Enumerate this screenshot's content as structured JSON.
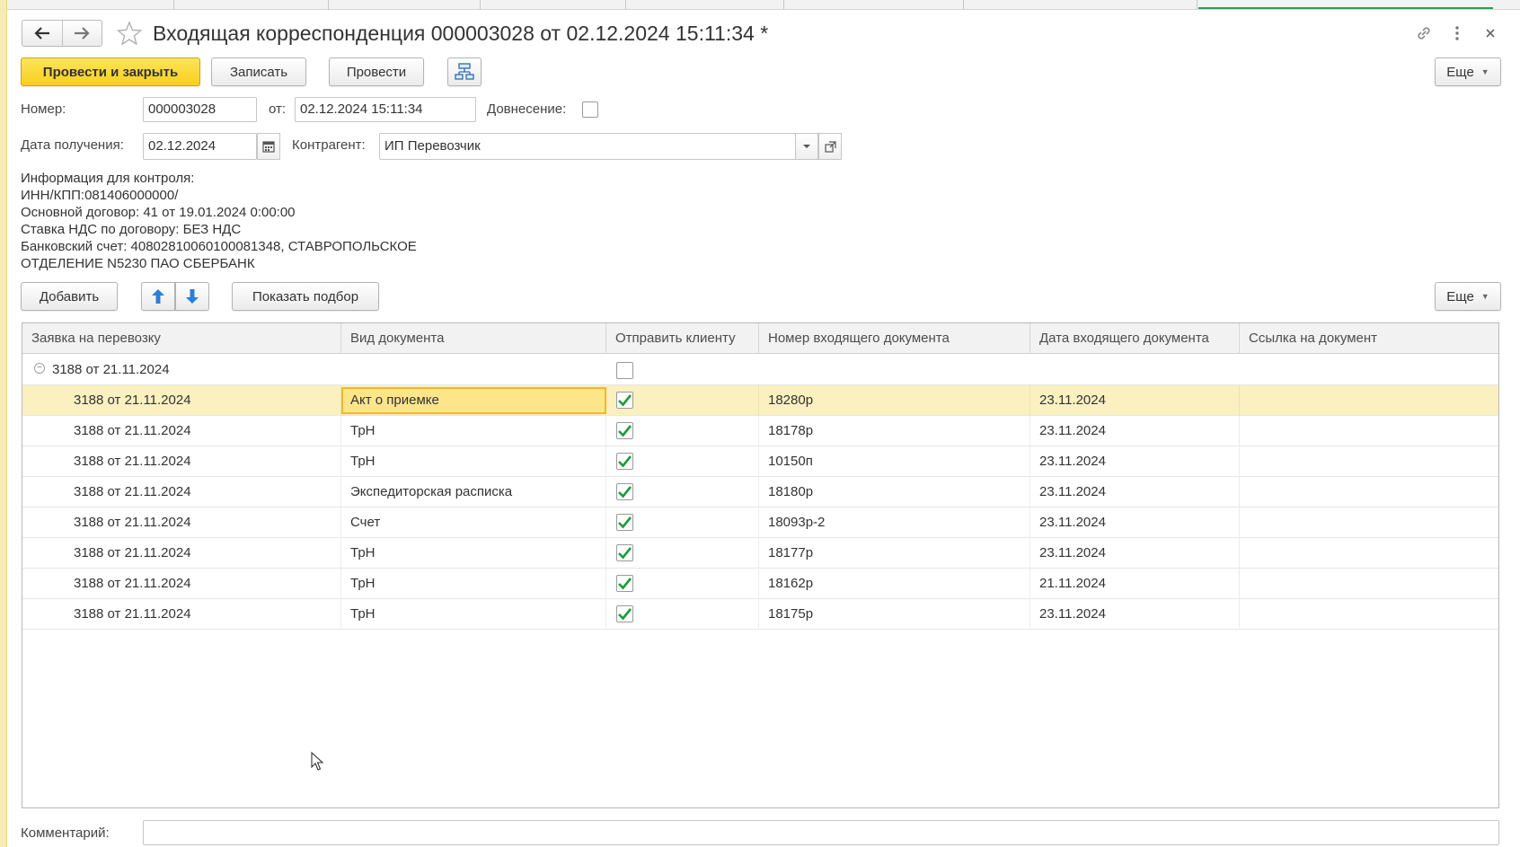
{
  "window": {
    "title": "Входящая корреспонденция 000003028 от 02.12.2024 15:11:34 *"
  },
  "toolbar": {
    "post_and_close": "Провести и закрыть",
    "save": "Записать",
    "post": "Провести",
    "more": "Еще"
  },
  "form": {
    "number_label": "Номер:",
    "number_value": "000003028",
    "from_label": "от:",
    "from_value": "02.12.2024 15:11:34",
    "late_delivery_label": "Довнесение:",
    "receipt_date_label": "Дата получения:",
    "receipt_date_value": "02.12.2024",
    "counterparty_label": "Контрагент:",
    "counterparty_value": "ИП Перевозчик"
  },
  "info": {
    "lines": [
      "Информация для контроля:",
      "ИНН/КПП:081406000000/",
      "Основной договор: 41 от 19.01.2024 0:00:00",
      "Ставка НДС по договору: БЕЗ НДС",
      "Банковский счет: 40802810060100081348, СТАВРОПОЛЬСКОЕ",
      "ОТДЕЛЕНИЕ N5230 ПАО СБЕРБАНК"
    ]
  },
  "table_toolbar": {
    "add": "Добавить",
    "show_selection": "Показать подбор",
    "more": "Еще"
  },
  "table": {
    "columns": [
      "Заявка на перевозку",
      "Вид документа",
      "Отправить клиенту",
      "Номер входящего документа",
      "Дата входящего документа",
      "Ссылка на документ"
    ],
    "group": {
      "label": "3188 от 21.11.2024",
      "checked": false
    },
    "rows": [
      {
        "request": "3188 от 21.11.2024",
        "doc_type": "Акт о приемке",
        "send": true,
        "number": "18280р",
        "date": "23.11.2024",
        "link": ""
      },
      {
        "request": "3188 от 21.11.2024",
        "doc_type": "ТрН",
        "send": true,
        "number": "18178р",
        "date": "23.11.2024",
        "link": ""
      },
      {
        "request": "3188 от 21.11.2024",
        "doc_type": "ТрН",
        "send": true,
        "number": "10150п",
        "date": "23.11.2024",
        "link": ""
      },
      {
        "request": "3188 от 21.11.2024",
        "doc_type": "Экспедиторская расписка",
        "send": true,
        "number": "18180р",
        "date": "23.11.2024",
        "link": ""
      },
      {
        "request": "3188 от 21.11.2024",
        "doc_type": "Счет",
        "send": true,
        "number": "18093р-2",
        "date": "23.11.2024",
        "link": ""
      },
      {
        "request": "3188 от 21.11.2024",
        "doc_type": "ТрН",
        "send": true,
        "number": "18177р",
        "date": "23.11.2024",
        "link": ""
      },
      {
        "request": "3188 от 21.11.2024",
        "doc_type": "ТрН",
        "send": true,
        "number": "18162р",
        "date": "21.11.2024",
        "link": ""
      },
      {
        "request": "3188 от 21.11.2024",
        "doc_type": "ТрН",
        "send": true,
        "number": "18175р",
        "date": "23.11.2024",
        "link": ""
      }
    ]
  },
  "footer": {
    "comment_label": "Комментарий:",
    "comment_value": ""
  },
  "icons": {
    "back": "arrow-left-icon",
    "forward": "arrow-right-icon",
    "favorite": "star-icon",
    "link": "link-icon",
    "menu": "kebab-menu-icon",
    "close": "close-icon",
    "structure": "structure-icon",
    "calendar": "calendar-icon",
    "dropdown": "chevron-down-icon",
    "open": "open-icon",
    "move_up": "arrow-up-icon",
    "move_down": "arrow-down-icon",
    "checkmark": "checkmark-icon",
    "collapse": "collapse-icon"
  },
  "colors": {
    "primary_button": "#f7cf1c",
    "selected_row": "#fbf0c0",
    "active_cell_border": "#f0b830",
    "checkmark": "#1f9a3c",
    "arrow_blue": "#2b7fd6",
    "active_tab": "#2e9e52"
  }
}
